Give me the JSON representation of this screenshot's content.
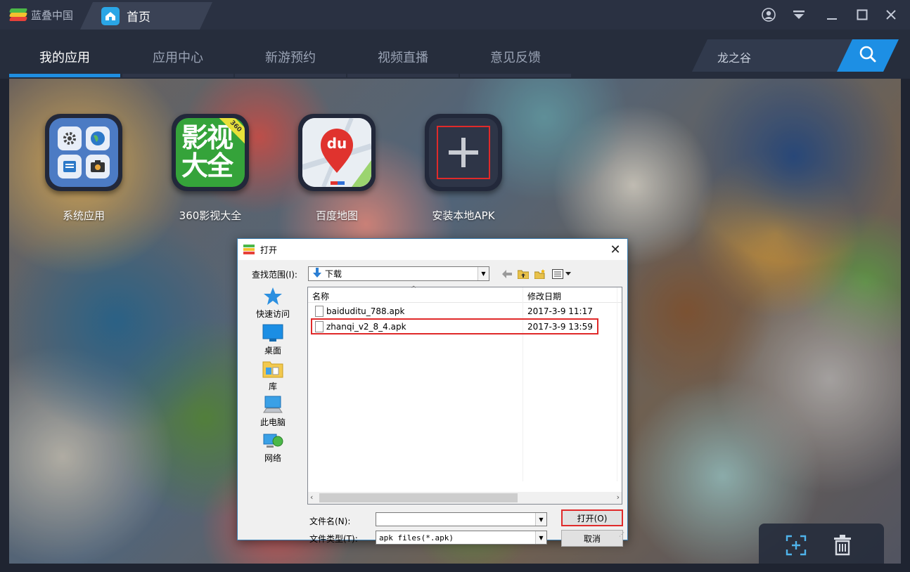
{
  "brand": {
    "name": "蓝叠中国"
  },
  "home_tab": {
    "label": "首页"
  },
  "window_controls": [
    "account-icon",
    "menu-icon",
    "minimize-icon",
    "maximize-icon",
    "close-icon"
  ],
  "nav": {
    "tabs": [
      {
        "label": "我的应用",
        "active": true
      },
      {
        "label": "应用中心",
        "active": false
      },
      {
        "label": "新游预约",
        "active": false
      },
      {
        "label": "视频直播",
        "active": false
      },
      {
        "label": "意见反馈",
        "active": false
      }
    ],
    "search": {
      "value": "龙之谷"
    }
  },
  "apps": [
    {
      "label": "系统应用"
    },
    {
      "label": "360影视大全",
      "icon_text": "影视大全",
      "badge": "360"
    },
    {
      "label": "百度地图",
      "icon_text": "du"
    },
    {
      "label": "安装本地APK"
    }
  ],
  "dialog": {
    "title": "打开",
    "look_in_label": "查找范围(I):",
    "look_in_value": "下载",
    "places": [
      "快速访问",
      "桌面",
      "库",
      "此电脑",
      "网络"
    ],
    "columns": [
      "名称",
      "修改日期"
    ],
    "files": [
      {
        "name": "baiduditu_788.apk",
        "date": "2017-3-9 11:17"
      },
      {
        "name": "zhanqi_v2_8_4.apk",
        "date": "2017-3-9 13:59"
      }
    ],
    "filename_label": "文件名(N):",
    "filename_value": "",
    "filetype_label": "文件类型(T):",
    "filetype_value": "apk files(*.apk)",
    "open_button": "打开(O)",
    "cancel_button": "取消"
  },
  "colors": {
    "accent": "#1d8fe4",
    "highlight": "#e02a2a",
    "titlebar": "#2a3142"
  }
}
